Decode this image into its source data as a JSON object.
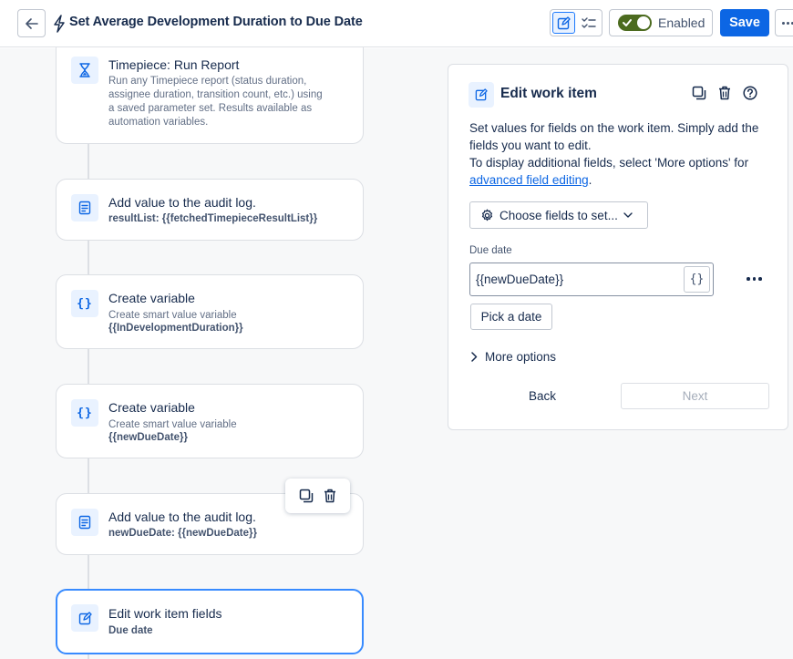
{
  "header": {
    "title": "Set Average Development Duration to Due Date",
    "enabled_label": "Enabled",
    "save_label": "Save"
  },
  "cards": [
    {
      "title": "Timepiece: Run Report",
      "subtitle_lines": [
        "Run any Timepiece report (status duration,",
        "assignee duration, transition count, etc.) using",
        "a saved parameter set. Results available as",
        "automation variables."
      ],
      "icon": "hourglass-icon"
    },
    {
      "title": "Add value to the audit log.",
      "detail": "resultList: {{fetchedTimepieceResultList}}",
      "icon": "audit-log-icon"
    },
    {
      "title": "Create variable",
      "subtitle": "Create smart value variable",
      "detail": "{{InDevelopmentDuration}}",
      "icon": "braces-icon"
    },
    {
      "title": "Create variable",
      "subtitle": "Create smart value variable",
      "detail": "{{newDueDate}}",
      "icon": "braces-icon"
    },
    {
      "title": "Add value to the audit log.",
      "detail": "newDueDate: {{newDueDate}}",
      "icon": "audit-log-icon"
    },
    {
      "title": "Edit work item fields",
      "detail": "Due date",
      "icon": "edit-icon"
    }
  ],
  "panel": {
    "title": "Edit work item",
    "desc_line1": "Set values for fields on the work item. Simply add the fields you want to edit.",
    "desc_line2": "To display additional fields, select 'More options' for",
    "desc_link": "advanced field editing",
    "desc_end": ".",
    "choose_fields_label": "Choose fields to set...",
    "field_label": "Due date",
    "field_value": "{{newDueDate}}",
    "brace_button": "{}",
    "pick_date_label": "Pick a date",
    "more_options_label": "More options",
    "back_label": "Back",
    "next_label": "Next"
  },
  "colors": {
    "accent": "#0c66e4",
    "toggle_on": "#4c6b1f",
    "selected_border": "#388bff",
    "icon_bg": "#e9f2ff"
  }
}
